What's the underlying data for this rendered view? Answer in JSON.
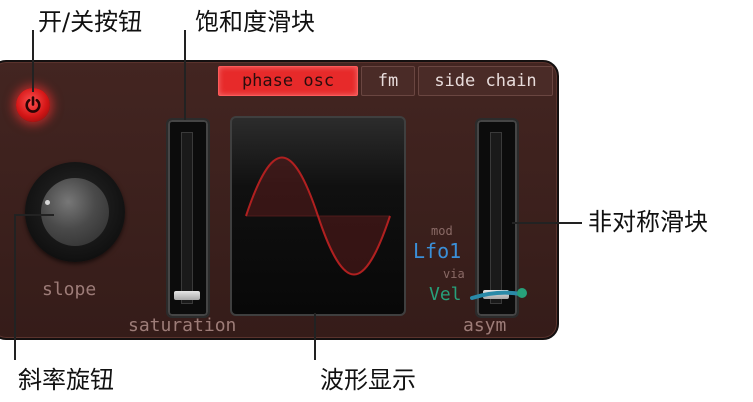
{
  "callouts": {
    "power": "开/关按钮",
    "saturation_slider": "饱和度滑块",
    "asym_slider": "非对称滑块",
    "slope_knob": "斜率旋钮",
    "wave_display": "波形显示"
  },
  "tabs": [
    {
      "label": "phase osc",
      "active": true
    },
    {
      "label": "fm",
      "active": false
    },
    {
      "label": "side chain",
      "active": false
    }
  ],
  "controls": {
    "slope_label": "slope",
    "saturation_label": "saturation",
    "asym_label": "asym",
    "mod_label": "mod",
    "mod_source": "Lfo1",
    "via_label": "via",
    "via_source": "Vel"
  },
  "colors": {
    "panel": "#3a1f1c",
    "active_tab": "#e72a2a",
    "mod_source": "#3a8fd8",
    "via_source": "#27a07a",
    "wave": "#b02020"
  },
  "icons": {
    "power": "power-icon"
  }
}
